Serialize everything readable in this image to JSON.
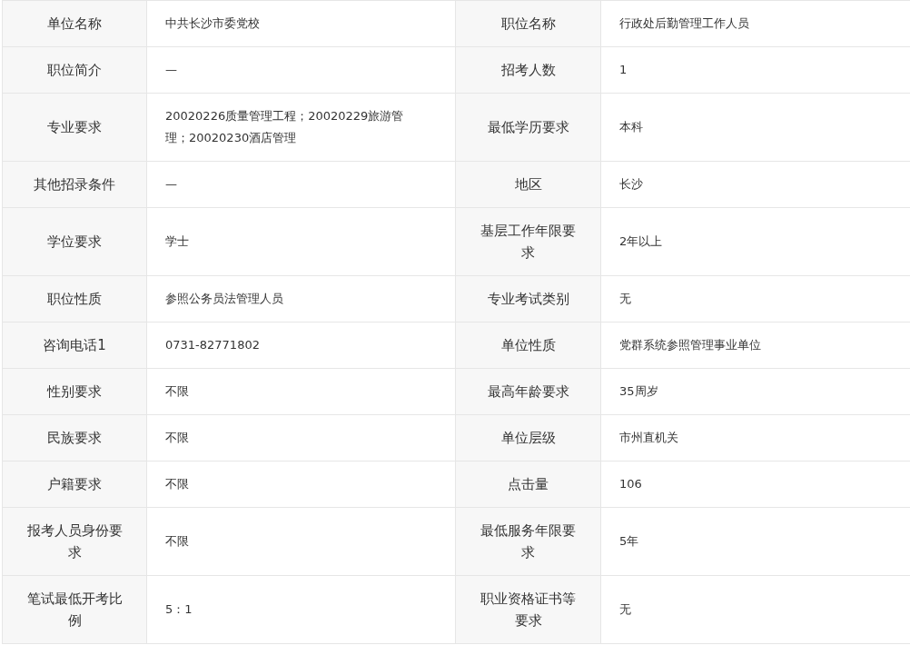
{
  "fields": [
    {
      "label": "单位名称",
      "value": "中共长沙市委党校"
    },
    {
      "label": "职位名称",
      "value": "行政处后勤管理工作人员"
    },
    {
      "label": "职位简介",
      "value": "—"
    },
    {
      "label": "招考人数",
      "value": "1"
    },
    {
      "label": "专业要求",
      "value": "20020226质量管理工程；20020229旅游管理；20020230酒店管理"
    },
    {
      "label": "最低学历要求",
      "value": "本科"
    },
    {
      "label": "其他招录条件",
      "value": "—"
    },
    {
      "label": "地区",
      "value": "长沙"
    },
    {
      "label": "学位要求",
      "value": "学士"
    },
    {
      "label": "基层工作年限要求",
      "value": "2年以上"
    },
    {
      "label": "职位性质",
      "value": "参照公务员法管理人员"
    },
    {
      "label": "专业考试类别",
      "value": "无"
    },
    {
      "label": "咨询电话1",
      "value": "0731-82771802"
    },
    {
      "label": "单位性质",
      "value": "党群系统参照管理事业单位"
    },
    {
      "label": "性别要求",
      "value": "不限"
    },
    {
      "label": "最高年龄要求",
      "value": "35周岁"
    },
    {
      "label": "民族要求",
      "value": "不限"
    },
    {
      "label": "单位层级",
      "value": "市州直机关"
    },
    {
      "label": "户籍要求",
      "value": "不限"
    },
    {
      "label": "点击量",
      "value": "106"
    },
    {
      "label": "报考人员身份要求",
      "value": "不限"
    },
    {
      "label": "最低服务年限要求",
      "value": "5年"
    },
    {
      "label": "笔试最低开考比例",
      "value": "5：1"
    },
    {
      "label": "职业资格证书等要求",
      "value": "无"
    }
  ]
}
